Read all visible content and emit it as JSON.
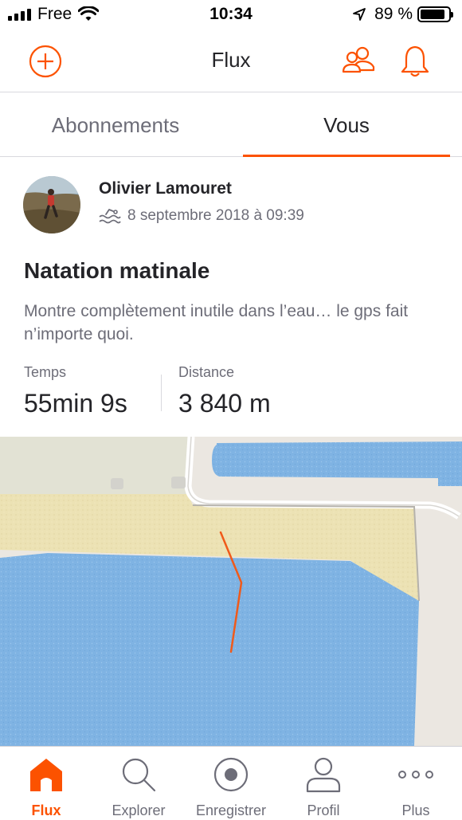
{
  "status_bar": {
    "carrier": "Free",
    "time": "10:34",
    "battery_percent": "89 %",
    "battery_level": 0.89,
    "icons": [
      "signal-icon",
      "wifi-icon",
      "location-arrow-icon",
      "battery-icon"
    ]
  },
  "nav": {
    "title": "Flux",
    "icons": [
      "plus-circle-icon",
      "people-icon",
      "bell-icon"
    ]
  },
  "tabs": [
    {
      "label": "Abonnements",
      "active": false
    },
    {
      "label": "Vous",
      "active": true
    }
  ],
  "activity": {
    "athlete_name": "Olivier Lamouret",
    "sport_icon": "swim-icon",
    "date": "8 septembre 2018 à 09:39",
    "title": "Natation matinale",
    "description": "Montre complètement inutile dans l’eau… le gps fait n’importe quoi.",
    "stats": [
      {
        "label": "Temps",
        "value": "55min 9s"
      },
      {
        "label": "Distance",
        "value": "3 840 m"
      }
    ]
  },
  "tab_bar": {
    "items": [
      {
        "label": "Flux",
        "icon": "home-icon",
        "active": true
      },
      {
        "label": "Explorer",
        "icon": "search-icon",
        "active": false
      },
      {
        "label": "Enregistrer",
        "icon": "record-icon",
        "active": false
      },
      {
        "label": "Profil",
        "icon": "profile-icon",
        "active": false
      },
      {
        "label": "Plus",
        "icon": "more-icon",
        "active": false
      }
    ]
  },
  "colors": {
    "accent": "#fc5200",
    "text_primary": "#242428",
    "text_secondary": "#6d6d78",
    "water": "#7fb3e3",
    "sand": "#ece2b4",
    "route": "#f05a1a"
  }
}
